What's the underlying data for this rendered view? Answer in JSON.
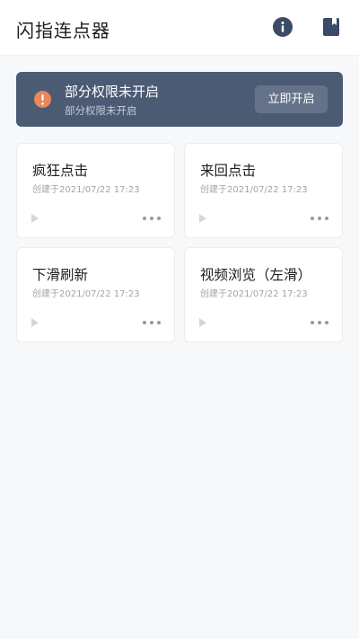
{
  "header": {
    "title": "闪指连点器",
    "info_icon": "info-icon",
    "book_icon": "book-icon"
  },
  "banner": {
    "title": "部分权限未开启",
    "subtitle": "部分权限未开启",
    "button_label": "立即开启",
    "icon": "warning-icon",
    "background_color": "#4b5b74",
    "icon_color": "#e8875a"
  },
  "cards": [
    {
      "title": "疯狂点击",
      "created": "创建于2021/07/22 17:23"
    },
    {
      "title": "来回点击",
      "created": "创建于2021/07/22 17:23"
    },
    {
      "title": "下滑刷新",
      "created": "创建于2021/07/22 17:23"
    },
    {
      "title": "视频浏览（左滑）",
      "created": "创建于2021/07/22 17:23"
    }
  ]
}
